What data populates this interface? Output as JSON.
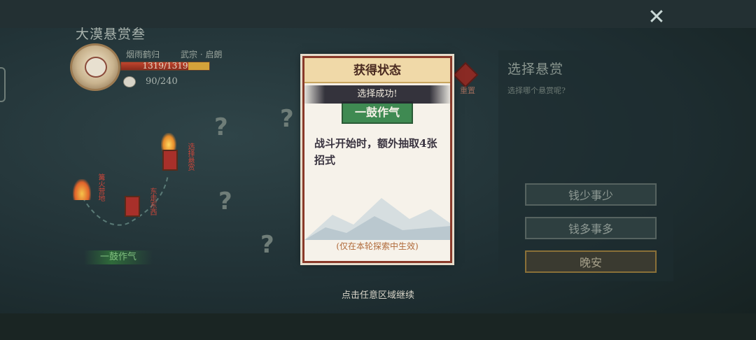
{
  "window": {
    "close_icon": "close-x-icon"
  },
  "map": {
    "title": "大漠悬赏叁",
    "player": {
      "name": "烟雨鹤归",
      "class": "武宗 · 启朗",
      "hp": "1319/1319",
      "hp_fraction": 1.0,
      "coins": "90/240"
    },
    "node_labels": {
      "choose_bounty": "选择悬赏",
      "explore_west": "东走东西",
      "camp": "篝火营地"
    },
    "status_tag": "一鼓作气"
  },
  "side_panel": {
    "title": "选择悬赏",
    "subtitle": "选择哪个悬赏呢?",
    "reset_label": "重置",
    "options": [
      {
        "label": "钱少事少"
      },
      {
        "label": "钱多事多"
      },
      {
        "label": "晚安"
      }
    ]
  },
  "dialog": {
    "title": "获得状态",
    "toast": "选择成功!",
    "effect_name": "一鼓作气",
    "effect_desc": "战斗开始时，额外抽取4张招式",
    "scope": "(仅在本轮探索中生效)"
  },
  "continue_hint": "点击任意区域继续",
  "colors": {
    "accent_green": "#3f8a52",
    "frame_red": "#8a3a2a",
    "hp_red": "#c0452e"
  }
}
